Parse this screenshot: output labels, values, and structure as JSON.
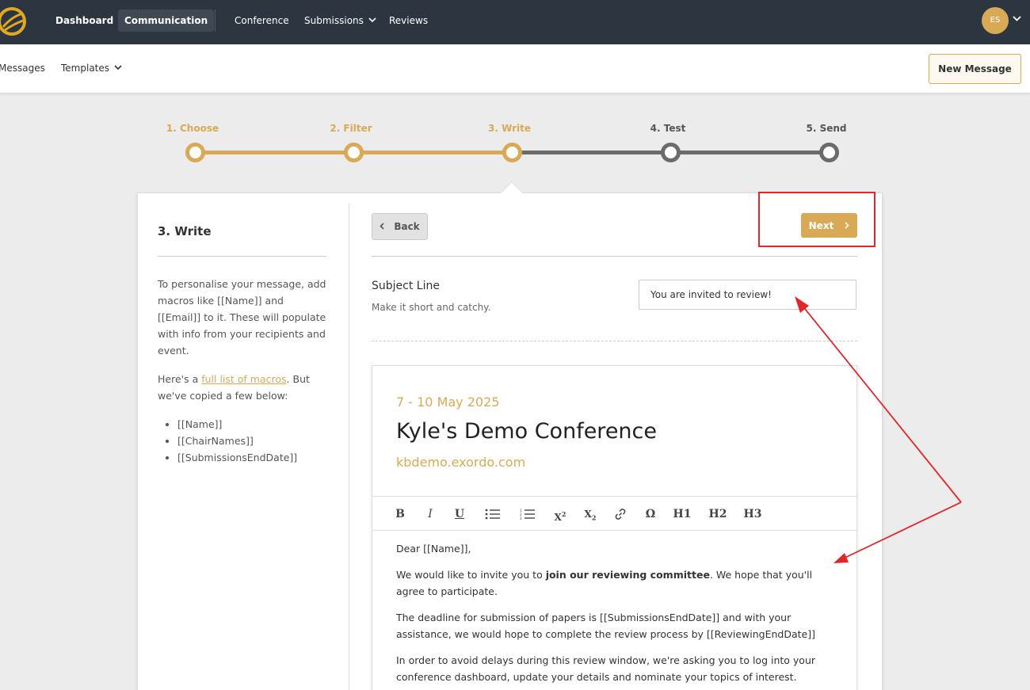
{
  "topnav": {
    "items": [
      {
        "label": "Dashboard"
      },
      {
        "label": "Communication"
      },
      {
        "label": "Conference"
      },
      {
        "label": "Submissions"
      },
      {
        "label": "Reviews"
      }
    ],
    "avatar_initials": "ES"
  },
  "subnav": {
    "messages_label": "Messages",
    "templates_label": "Templates",
    "new_message_label": "New Message"
  },
  "stepper": {
    "steps": [
      {
        "label": "1. Choose",
        "done": true
      },
      {
        "label": "2. Filter",
        "done": true
      },
      {
        "label": "3. Write",
        "done": true
      },
      {
        "label": "4. Test",
        "done": false
      },
      {
        "label": "5. Send",
        "done": false
      }
    ]
  },
  "sidebar": {
    "title": "3. Write",
    "intro": "To personalise your message, add macros like [[Name]] and [[Email]] to it. These will populate with info from your recipients and event.",
    "macros_prefix": "Here's a ",
    "macros_link": "full list of macros",
    "macros_suffix": ". But we've copied a few below:",
    "macros": [
      "[[Name]]",
      "[[ChairNames]]",
      "[[SubmissionsEndDate]]"
    ]
  },
  "actions": {
    "back_label": "Back",
    "next_label": "Next"
  },
  "subject": {
    "title": "Subject Line",
    "help": "Make it short and catchy.",
    "value": "You are invited to review!"
  },
  "email": {
    "date": "7 - 10 May 2025",
    "title": "Kyle's Demo Conference",
    "url": "kbdemo.exordo.com",
    "toolbar": [
      "B",
      "I",
      "U",
      "bullet-list",
      "numbered-list",
      "X2",
      "X2",
      "link",
      "Ω",
      "H1",
      "H2",
      "H3"
    ],
    "greeting": "Dear [[Name]],",
    "p1_before": "We would like to invite you to ",
    "p1_bold": "join our reviewing committee",
    "p1_after": ". We hope that you'll agree to participate.",
    "p2": "The deadline for submission of papers is [[SubmissionsEndDate]] and with your assistance, we would hope to complete the review process by [[ReviewingEndDate]]",
    "p3": "In order to avoid delays during this review window, we're asking you to log into your conference dashboard, update your details and nominate your topics of interest."
  },
  "colors": {
    "accent": "#d9a955",
    "nav_bg": "#2d3640",
    "annotation": "#e3262a",
    "step_off": "#6b6b6b"
  }
}
